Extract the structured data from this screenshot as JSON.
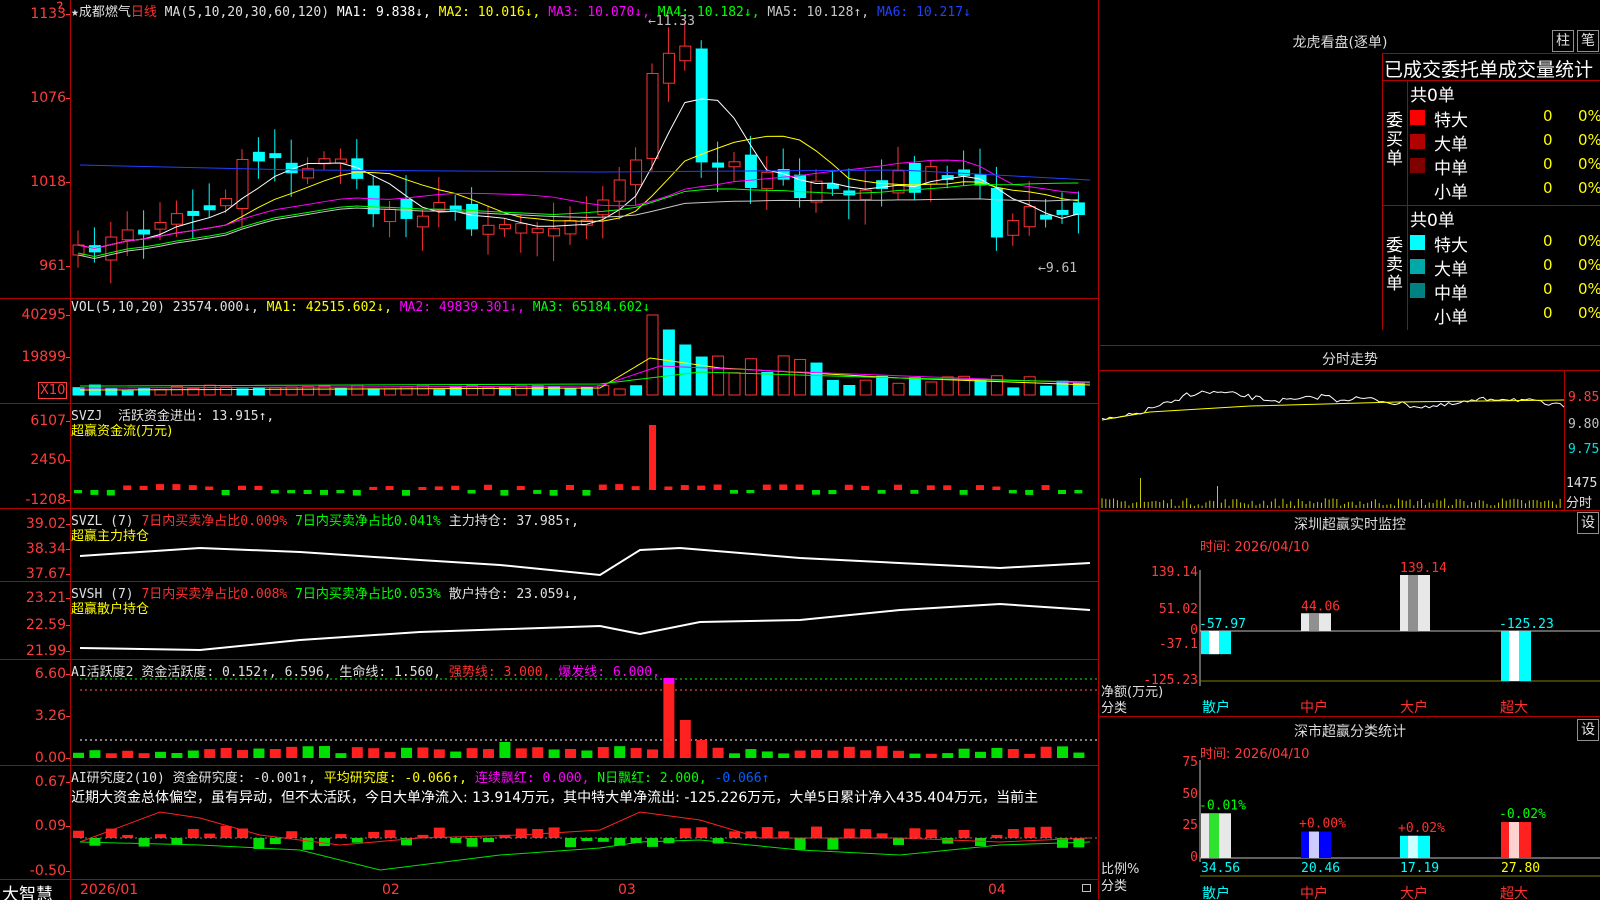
{
  "top_left_mark": "?",
  "kline": {
    "stock_name": "★成都燃气",
    "period": "日线",
    "ma_label": "MA(5,10,20,30,60,120)",
    "ma1": "MA1: 9.838↓,",
    "ma2": "MA2: 10.016↓,",
    "ma3": "MA3: 10.070↓,",
    "ma4": "MA4: 10.182↓,",
    "ma5": "MA5: 10.128↑,",
    "ma6": "MA6: 10.217↓",
    "axis": [
      "1133",
      "1076",
      "1018",
      "961"
    ],
    "high_note": "11.33",
    "low_note": "←9.61"
  },
  "vol": {
    "label": "VOL(5,10,20)",
    "value": "23574.000↓,",
    "ma1": "MA1: 42515.602↓,",
    "ma2": "MA2: 49839.301↓,",
    "ma3": "MA3: 65184.602↓",
    "axis": [
      "40295",
      "19899"
    ],
    "unit": "X10"
  },
  "svzj": {
    "label": "SVZJ",
    "desc": "活跃资金进出: 13.915↑,",
    "subtitle": "超赢资金流(万元)",
    "axis": [
      "6107",
      "2450",
      "-1208"
    ]
  },
  "svzl": {
    "label": "SVZL (7)",
    "p1": "7日内买卖净占比0.009%",
    "p2": "7日内买卖净占比0.041%",
    "p3": "主力持仓: 37.985↑,",
    "subtitle": "超赢主力持仓",
    "axis": [
      "39.02",
      "38.34",
      "37.67"
    ]
  },
  "svsh": {
    "label": "SVSH (7)",
    "p1": "7日内买卖净占比0.008%",
    "p2": "7日内买卖净占比0.053%",
    "p3": "散户持仓: 23.059↓,",
    "subtitle": "超赢散户持仓",
    "axis": [
      "23.21",
      "22.59",
      "21.99"
    ]
  },
  "ai1": {
    "label": "AI活跃度2",
    "p1": "资金活跃度: 0.152↑,",
    "p2": "6.596,",
    "p3": "生命线: 1.560,",
    "p4": "强势线: 3.000,",
    "p5": "爆发线: 6.000,",
    "axis": [
      "6.60",
      "3.26",
      "0.00"
    ]
  },
  "ai2": {
    "label": "AI研究度2(10)",
    "p1": "资金研究度: -0.001↑,",
    "p2": "平均研究度: -0.066↑,",
    "p3": "连续飘红: 0.000,",
    "p4": "N日飘红: 2.000,",
    "p5": "-0.066↑",
    "comment": "近期大资金总体偏空，虽有异动，但不太活跃，今日大单净流入: 13.914万元，其中特大单净流出: -125.226万元，大单5日累计净入435.404万元，当前主",
    "axis": [
      "0.67",
      "0.09",
      "-0.50"
    ]
  },
  "xaxis": {
    "brand": "大智慧",
    "labels": [
      "2026/01",
      "02",
      "03",
      "04"
    ]
  },
  "lhb": {
    "title": "龙虎看盘(逐单)",
    "btn1": "柱",
    "btn2": "笔",
    "subtitle": "已成交委托单成交量统计",
    "buy_label": "委买单",
    "sell_label": "委卖单",
    "buy_total": "共0单",
    "sell_total": "共0单",
    "buy_rows": [
      {
        "name": "特大",
        "count": "0",
        "pct": "0%",
        "color": "#ff0000"
      },
      {
        "name": "大单",
        "count": "0",
        "pct": "0%",
        "color": "#b00000"
      },
      {
        "name": "中单",
        "count": "0",
        "pct": "0%",
        "color": "#800000"
      },
      {
        "name": "小单",
        "count": "0",
        "pct": "0%",
        "color": "#000000"
      }
    ],
    "sell_rows": [
      {
        "name": "特大",
        "count": "0",
        "pct": "0%",
        "color": "#00ffff"
      },
      {
        "name": "大单",
        "count": "0",
        "pct": "0%",
        "color": "#00a8a8"
      },
      {
        "name": "中单",
        "count": "0",
        "pct": "0%",
        "color": "#008080"
      },
      {
        "name": "小单",
        "count": "0",
        "pct": "0%",
        "color": "#000000"
      }
    ]
  },
  "fenshi": {
    "title": "分时走势",
    "axis": [
      "9.85",
      "9.80",
      "9.75"
    ],
    "vol_value": "1475",
    "vol_unit": "分时"
  },
  "szmonitor": {
    "title": "深圳超赢实时监控",
    "btn": "设",
    "time": "时间: 2026/04/10",
    "axis": [
      "139.14",
      "51.02",
      "0",
      "-37.1",
      "-125.23"
    ],
    "unit": "净额(万元)",
    "cat_label": "分类",
    "categories": [
      "散户",
      "中户",
      "大户",
      "超大"
    ],
    "values": [
      -57.97,
      44.06,
      139.14,
      -125.23
    ],
    "value_labels": [
      "-57.97",
      "44.06",
      "139.14",
      "-125.23"
    ]
  },
  "szclass": {
    "title": "深市超赢分类统计",
    "btn": "设",
    "time": "时间: 2026/04/10",
    "axis": [
      "75",
      "50",
      "25",
      "0"
    ],
    "unit": "比例%",
    "cat_label": "分类",
    "categories": [
      "散户",
      "中户",
      "大户",
      "超大"
    ],
    "values": [
      34.56,
      20.46,
      17.19,
      27.8
    ],
    "value_labels": [
      "34.56",
      "20.46",
      "17.19",
      "27.80"
    ],
    "changes": [
      "-0.01%",
      "+0.00%",
      "+0.02%",
      "-0.02%"
    ]
  },
  "chart_data": {
    "type": "bar",
    "title": "深圳超赢实时监控",
    "categories": [
      "散户",
      "中户",
      "大户",
      "超大"
    ],
    "series": [
      {
        "values": [
          -57.97,
          44.06,
          139.14,
          -125.23
        ]
      }
    ],
    "ylabel": "净额(万元)",
    "ylim": [
      -125.23,
      139.14
    ]
  }
}
